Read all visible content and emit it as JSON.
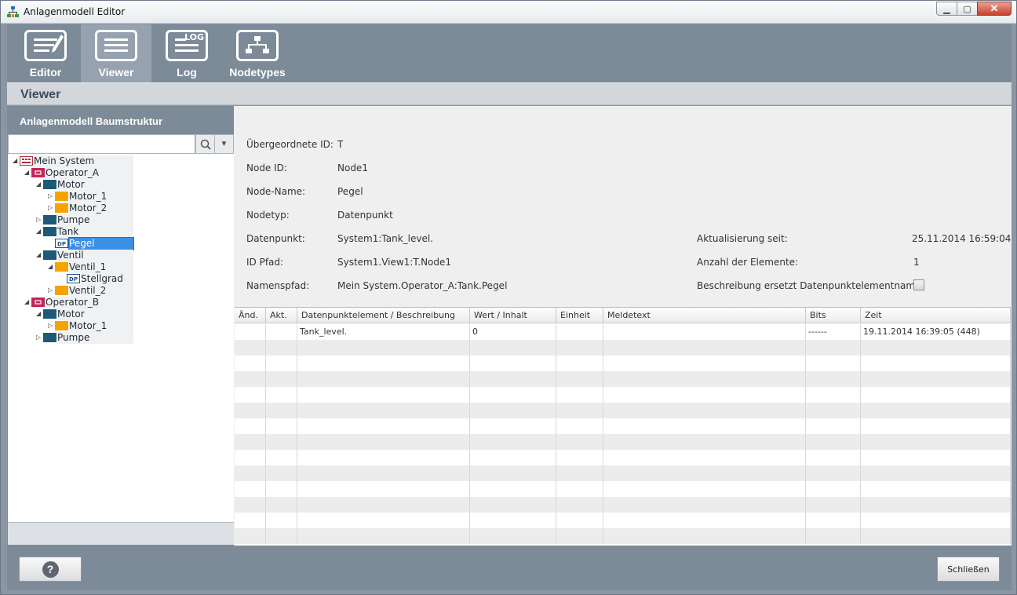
{
  "window": {
    "title": "Anlagenmodell Editor"
  },
  "toolbar": {
    "items": [
      {
        "label": "Editor"
      },
      {
        "label": "Viewer"
      },
      {
        "label": "Log",
        "badge": "LOG"
      },
      {
        "label": "Nodetypes"
      }
    ],
    "active": "Viewer"
  },
  "view_title": "Viewer",
  "left_panel": {
    "title": "Anlagenmodell Baumstruktur",
    "search": {
      "value": "",
      "placeholder": ""
    }
  },
  "tree": [
    {
      "label": "Mein System",
      "icon": "system-icon",
      "expander": "expanded"
    },
    {
      "label": "Operator_A",
      "icon": "operator-icon",
      "expander": "expanded"
    },
    {
      "label": "Motor",
      "icon": "folder-dark-icon",
      "expander": "expanded"
    },
    {
      "label": "Motor_1",
      "icon": "folder-orange-icon",
      "expander": "collapsed"
    },
    {
      "label": "Motor_2",
      "icon": "folder-orange-icon",
      "expander": "collapsed"
    },
    {
      "label": "Pumpe",
      "icon": "folder-dark-icon",
      "expander": "collapsed"
    },
    {
      "label": "Tank",
      "icon": "folder-dark-icon",
      "expander": "expanded"
    },
    {
      "label": "Pegel",
      "icon": "datapoint-icon",
      "expander": "none",
      "selected": true
    },
    {
      "label": "Ventil",
      "icon": "folder-dark-icon",
      "expander": "expanded"
    },
    {
      "label": "Ventil_1",
      "icon": "folder-orange-icon",
      "expander": "expanded"
    },
    {
      "label": "Stellgrad",
      "icon": "datapoint-icon",
      "expander": "none"
    },
    {
      "label": "Ventil_2",
      "icon": "folder-orange-icon",
      "expander": "collapsed"
    },
    {
      "label": "Operator_B",
      "icon": "operator-icon",
      "expander": "expanded"
    },
    {
      "label": "Motor",
      "icon": "folder-dark-icon",
      "expander": "expanded"
    },
    {
      "label": "Motor_1",
      "icon": "folder-orange-icon",
      "expander": "collapsed"
    },
    {
      "label": "Pumpe",
      "icon": "folder-dark-icon",
      "expander": "collapsed"
    }
  ],
  "details": {
    "parent_id": {
      "label": "Übergeordnete ID:",
      "value": "T"
    },
    "node_id": {
      "label": "Node ID:",
      "value": "Node1"
    },
    "node_name": {
      "label": "Node-Name:",
      "value": "Pegel"
    },
    "nodetype": {
      "label": "Nodetyp:",
      "value": "Datenpunkt"
    },
    "datapoint": {
      "label": "Datenpunkt:",
      "value": "System1:Tank_level."
    },
    "id_path": {
      "label": "ID Pfad:",
      "value": "System1.View1:T.Node1"
    },
    "name_path": {
      "label": "Namenspfad:",
      "value": "Mein System.Operator_A:Tank.Pegel"
    },
    "updated_since": {
      "label": "Aktualisierung seit:",
      "value": "25.11.2014 16:59:04"
    },
    "element_count": {
      "label": "Anzahl der Elemente:",
      "value": "1"
    },
    "desc_replaces": {
      "label": "Beschreibung ersetzt Datenpunktelementname:",
      "checked": false
    }
  },
  "table": {
    "columns": [
      "Änd.",
      "Akt.",
      "Datenpunktelement / Beschreibung",
      "Wert / Inhalt",
      "Einheit",
      "Meldetext",
      "Bits",
      "Zeit"
    ],
    "rows": [
      [
        "",
        "",
        "Tank_level.",
        "0",
        "",
        "",
        "------",
        "19.11.2014 16:39:05  (448)"
      ]
    ],
    "empty_rows": 13
  },
  "footer": {
    "help_label": "?",
    "close_label": "Schließen"
  },
  "colors": {
    "chrome": "#7d8a98",
    "active_tab": "#96a2af",
    "selection": "#3b8fe4",
    "operator": "#c8235a",
    "folder_dark": "#1c5a78",
    "folder_orange": "#f5a300"
  }
}
